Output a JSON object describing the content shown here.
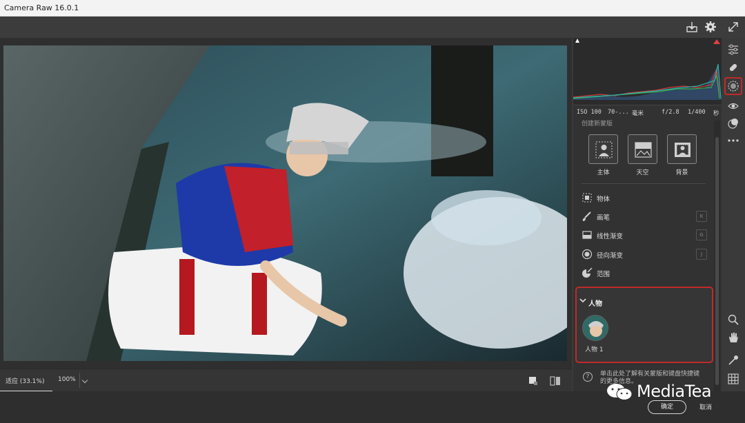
{
  "window": {
    "title": "Camera Raw 16.0.1"
  },
  "toolbar": {
    "icons": [
      "export-icon",
      "settings-icon",
      "fullscreen-icon"
    ]
  },
  "photo": {
    "description_icon": "photo-canvas"
  },
  "status": {
    "fit_label": "适应 (33.1%)",
    "zoom_label": "100%"
  },
  "histogram": {
    "colors": {
      "red": "#d23a3a",
      "green": "#3aaa4a",
      "blue": "#3a7ad2",
      "teal": "#2ab0b0"
    }
  },
  "meta": {
    "iso": "ISO 100",
    "lens": "70-...",
    "unit": "毫米",
    "aperture": "f/2.8",
    "shutter": "1/400",
    "sec": "秒"
  },
  "masks": {
    "create_header": "创建新蒙版",
    "subject_buttons": [
      {
        "label": "主体",
        "icon": "person-subject-icon"
      },
      {
        "label": "天空",
        "icon": "sky-icon"
      },
      {
        "label": "背景",
        "icon": "background-icon"
      }
    ],
    "tools": [
      {
        "label": "物体",
        "icon": "object-select-icon",
        "shortcut": ""
      },
      {
        "label": "画笔",
        "icon": "brush-icon",
        "shortcut": "K"
      },
      {
        "label": "线性渐变",
        "icon": "linear-gradient-icon",
        "shortcut": "G"
      },
      {
        "label": "径向渐变",
        "icon": "radial-gradient-icon",
        "shortcut": "J"
      },
      {
        "label": "范围",
        "icon": "range-icon",
        "shortcut": ""
      }
    ],
    "people_section": {
      "title": "人物",
      "person_name": "人物 1"
    },
    "help_text": "单击此处了解有关蒙版和键盘快捷键的更多信息。"
  },
  "buttons": {
    "ok": "确定",
    "cancel": "取消"
  },
  "watermark": {
    "text": "MediaTea"
  },
  "accent": {
    "highlight_red": "#c22a2a"
  }
}
